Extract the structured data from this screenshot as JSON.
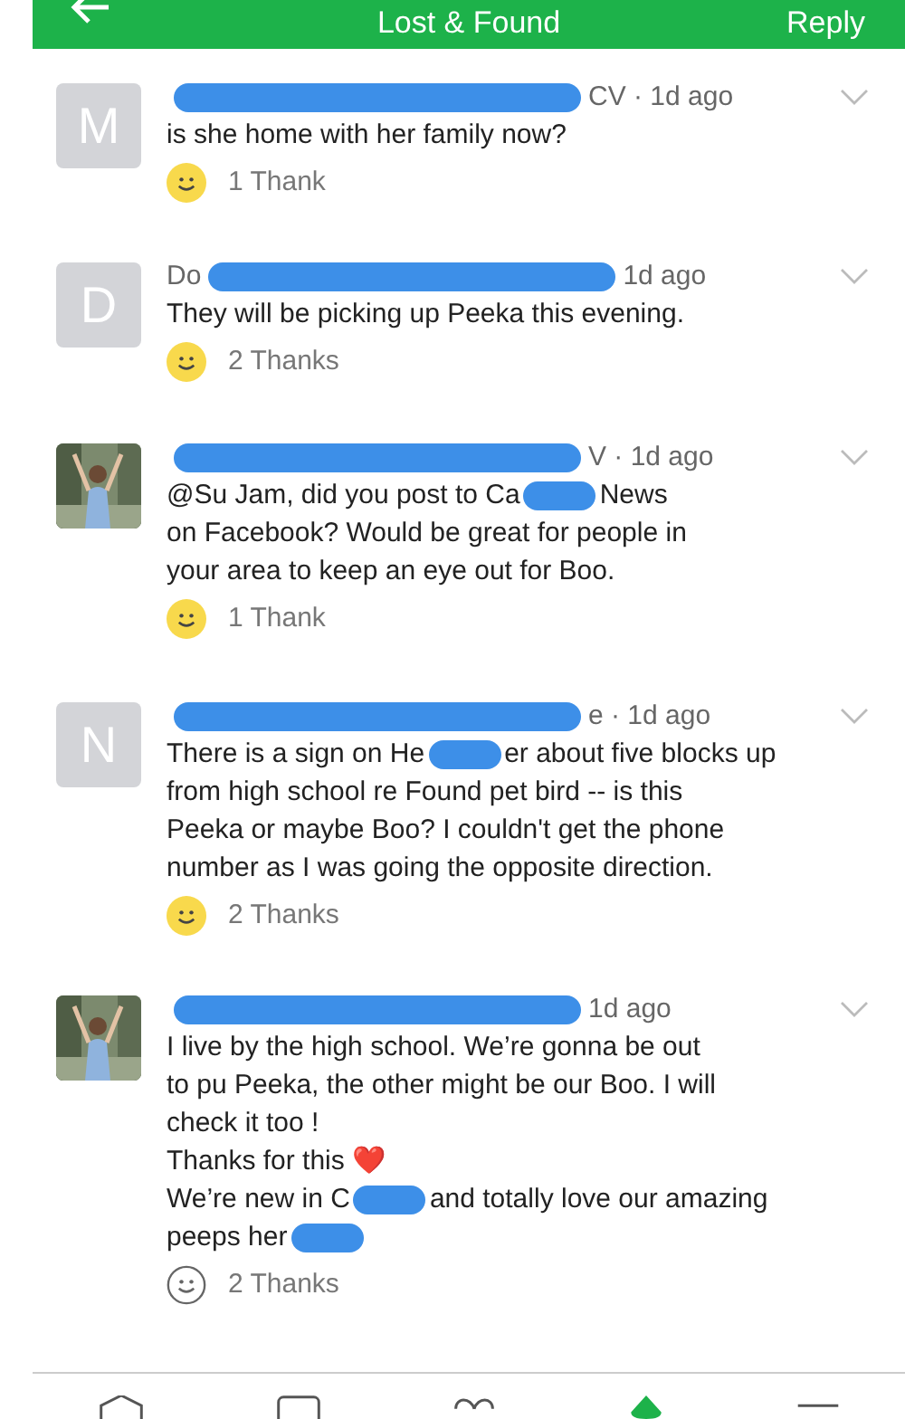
{
  "header": {
    "title": "Lost & Found",
    "action": "Reply"
  },
  "comments": [
    {
      "avatar": {
        "kind": "letter",
        "letter": "M"
      },
      "meta": "CV · 1d ago",
      "lines": [
        [
          "is she home with her family now?"
        ]
      ],
      "thanks": "1 Thank",
      "thanked": true
    },
    {
      "avatar": {
        "kind": "letter",
        "letter": "D"
      },
      "author_visible": "Do",
      "meta": "1d ago",
      "lines": [
        [
          "They will be picking up Peeka this evening."
        ]
      ],
      "thanks": "2 Thanks",
      "thanked": true
    },
    {
      "avatar": {
        "kind": "picture"
      },
      "meta": "V · 1d ago",
      "lines": [
        [
          "@Su Jam, did you post to Ca",
          {
            "kind": "redaction"
          },
          "News"
        ],
        [
          "on Facebook? Would be great for people in"
        ],
        [
          "your area to keep an eye out for Boo."
        ]
      ],
      "thanks": "1 Thank",
      "thanked": true
    },
    {
      "avatar": {
        "kind": "letter",
        "letter": "N"
      },
      "meta": "e · 1d ago",
      "lines": [
        [
          "There is a sign on He",
          {
            "kind": "redaction"
          },
          "er about five blocks up"
        ],
        [
          "from high school re Found pet bird -- is this"
        ],
        [
          "Peeka or maybe Boo? I couldn't get the phone"
        ],
        [
          "number as I was going the opposite direction."
        ]
      ],
      "thanks": "2 Thanks",
      "thanked": true
    },
    {
      "avatar": {
        "kind": "picture"
      },
      "meta": "1d ago",
      "lines": [
        [
          "I live by the high school. We’re gonna be out"
        ],
        [
          "to pu Peeka, the other might be our Boo. I will"
        ],
        [
          "check it too !"
        ],
        [
          "Thanks for this ❤️"
        ],
        [
          "We’re new in C",
          {
            "kind": "redaction"
          },
          "and totally love our amazing"
        ],
        [
          "peeps her",
          {
            "kind": "redaction"
          }
        ]
      ],
      "thanks": "2 Thanks",
      "thanked": false
    }
  ],
  "tabs": [
    {
      "kind": "home",
      "selected": false
    },
    {
      "kind": "chat",
      "selected": false
    },
    {
      "kind": "heart",
      "selected": false
    },
    {
      "kind": "pin",
      "selected": true
    },
    {
      "kind": "menu",
      "selected": false
    }
  ]
}
